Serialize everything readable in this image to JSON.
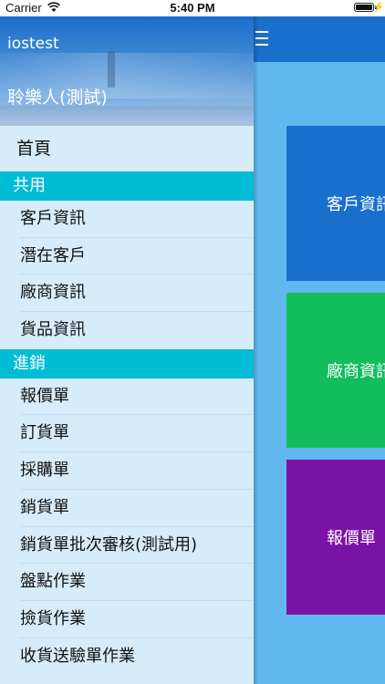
{
  "status_bar": {
    "carrier": "Carrier",
    "time": "5:40 PM",
    "wifi_icon": "wifi-icon",
    "battery_icon": "battery-icon",
    "charging_icon": "lightning-bolt-icon"
  },
  "drawer": {
    "app_name": "iostest",
    "user_name": "聆樂人(測試)",
    "home_label": "首頁",
    "sections": [
      {
        "title": "共用",
        "items": [
          "客戶資訊",
          "潛在客戶",
          "廠商資訊",
          "貨品資訊"
        ]
      },
      {
        "title": "進銷",
        "items": [
          "報價單",
          "訂貨單",
          "採購單",
          "銷貨單",
          "銷貨單批次審核(測試用)",
          "盤點作業",
          "撿貨作業",
          "收貨送驗單作業"
        ]
      }
    ]
  },
  "main": {
    "menu_icon": "hamburger-menu-icon",
    "tiles": [
      {
        "label": "客戶資訊",
        "color": "#1a6fcc"
      },
      {
        "label": "廠商資訊",
        "color": "#12be5c"
      },
      {
        "label": "報價單",
        "color": "#7a12a6"
      }
    ]
  },
  "colors": {
    "navbar": "#1a6fcc",
    "section_header": "#00bcd4",
    "drawer_background": "#d7ecfa",
    "main_background": "#61b8ef"
  }
}
